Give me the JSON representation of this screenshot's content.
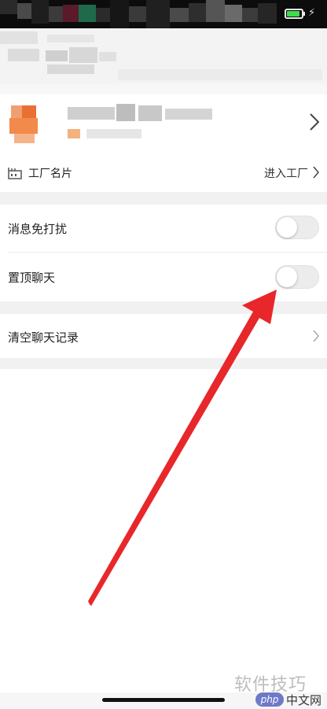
{
  "status_bar": {
    "battery_color": "#3ddc4a"
  },
  "factory_card": {
    "label": "工厂名片",
    "action": "进入工厂"
  },
  "settings": {
    "mute": {
      "label": "消息免打扰",
      "enabled": false
    },
    "pin": {
      "label": "置顶聊天",
      "enabled": false
    },
    "clear": {
      "label": "清空聊天记录"
    }
  },
  "annotation": {
    "arrow_color": "#e8272b"
  },
  "watermark": {
    "text": "软件技巧",
    "badge": "php",
    "site": "中文网"
  }
}
